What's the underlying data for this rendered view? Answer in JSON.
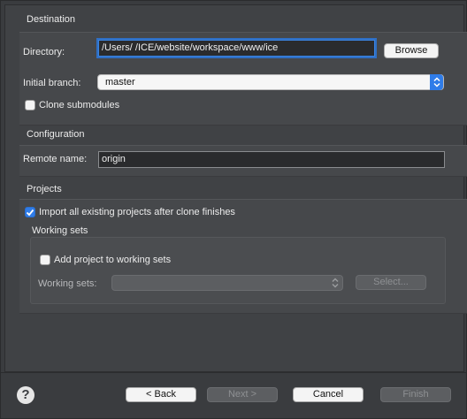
{
  "destination": {
    "title": "Destination",
    "directory_label": "Directory:",
    "directory_value": "/Users/    /ICE/website/workspace/www/ice",
    "browse_label": "Browse",
    "branch_label": "Initial branch:",
    "branch_value": "master",
    "clone_submodules_label": "Clone submodules"
  },
  "configuration": {
    "title": "Configuration",
    "remote_label": "Remote name:",
    "remote_value": "origin"
  },
  "projects": {
    "title": "Projects",
    "import_label": "Import all existing projects after clone finishes",
    "working_sets": {
      "title": "Working sets",
      "add_label": "Add project to working sets",
      "sets_label": "Working sets:",
      "select_label": "Select..."
    }
  },
  "footer": {
    "help_icon": "?",
    "back_label": "< Back",
    "next_label": "Next >",
    "cancel_label": "Cancel",
    "finish_label": "Finish"
  },
  "colors": {
    "accent": "#2f7ce8",
    "background": "#3a3c3f"
  }
}
